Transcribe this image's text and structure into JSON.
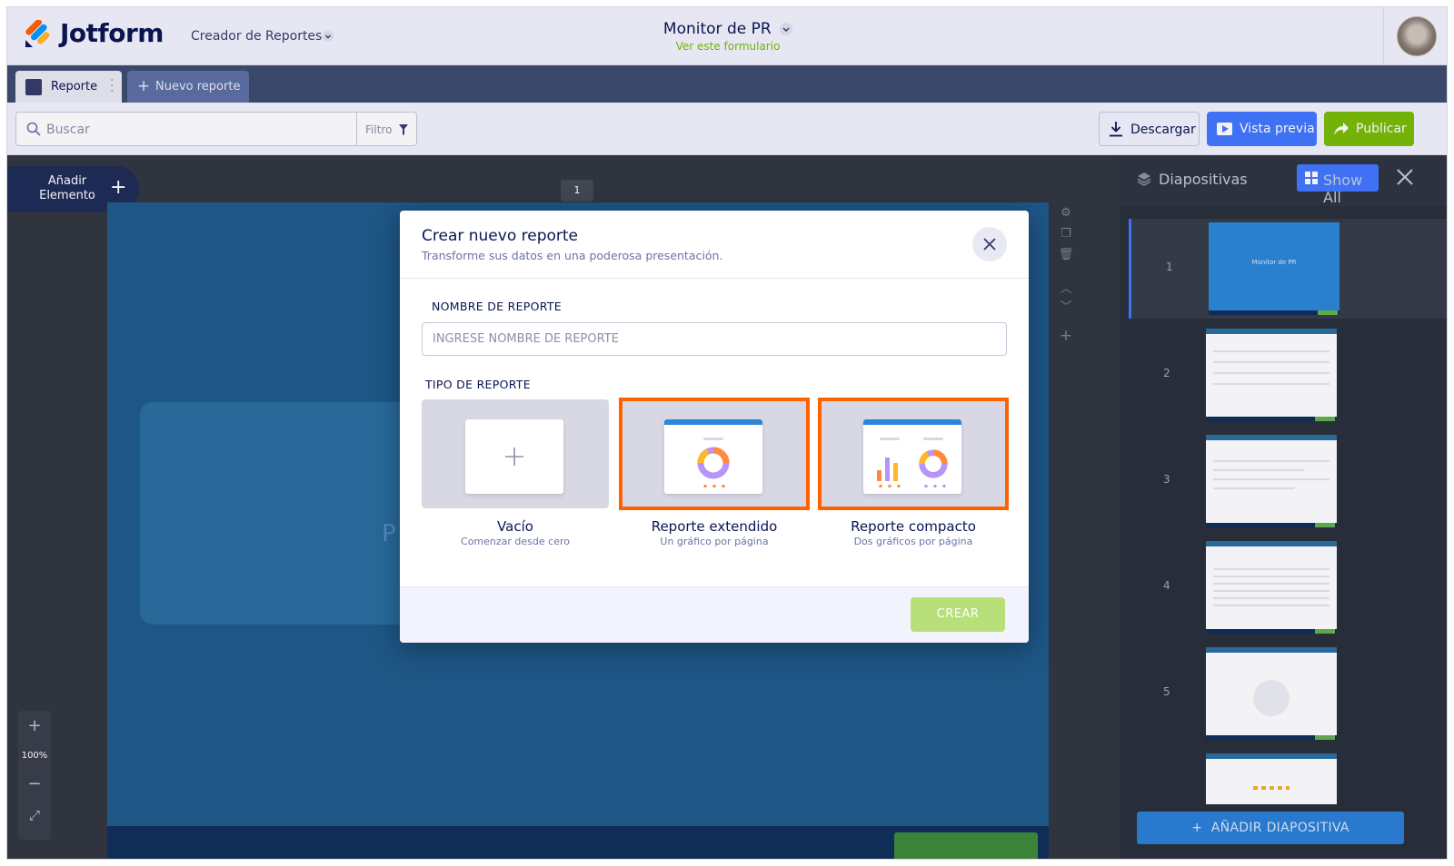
{
  "header": {
    "brand": "Jotform",
    "app_name": "Creador de Reportes",
    "form_title": "Monitor de PR",
    "form_link": "Ver este formulario"
  },
  "tabs": {
    "active_label": "Reporte",
    "new_label": "Nuevo reporte"
  },
  "toolbar": {
    "search_placeholder": "Buscar",
    "filter_label": "Filtro",
    "download_label": "Descargar",
    "preview_label": "Vista previa",
    "publish_label": "Publicar"
  },
  "workspace": {
    "add_element_label": "Añadir Elemento",
    "page_number": "1",
    "slide_partial_text": "P",
    "zoom_level": "100%"
  },
  "slides_panel": {
    "title": "Diapositivas",
    "show_all_label": "Show All",
    "slide_numbers": [
      "1",
      "2",
      "3",
      "4",
      "5"
    ],
    "thumb_title": "Monitor de PR",
    "add_slide_label": "AÑADIR DIAPOSITIVA"
  },
  "modal": {
    "title": "Crear nuevo reporte",
    "subtitle": "Transforme sus datos en una poderosa presentación.",
    "name_label": "NOMBRE DE REPORTE",
    "name_placeholder": "INGRESE NOMBRE DE REPORTE",
    "type_label": "TIPO DE REPORTE",
    "options": [
      {
        "title": "Vacío",
        "subtitle": "Comenzar desde cero",
        "selected": false
      },
      {
        "title": "Reporte extendido",
        "subtitle": "Un gráfico por página",
        "selected": true
      },
      {
        "title": "Reporte compacto",
        "subtitle": "Dos gráficos por página",
        "selected": true
      }
    ],
    "create_label": "CREAR"
  },
  "colors": {
    "brand_navy": "#0a1551",
    "accent_blue": "#4277ff",
    "publish_green": "#78bb07",
    "highlight_orange": "#ff6100"
  }
}
